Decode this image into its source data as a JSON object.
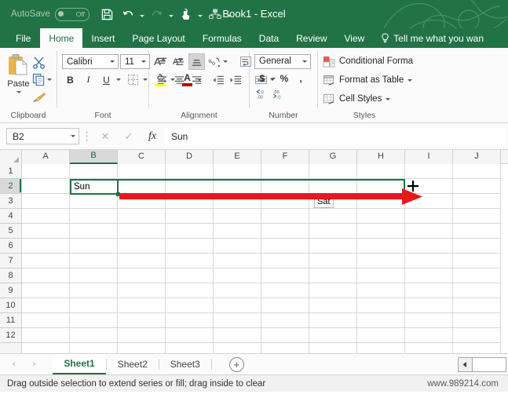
{
  "titlebar": {
    "autosave_label": "AutoSave",
    "autosave_state": "Off",
    "title": "Book1  -  Excel",
    "qat": [
      {
        "name": "save-icon",
        "label": "Save"
      },
      {
        "name": "undo-icon",
        "label": "Undo"
      },
      {
        "name": "redo-icon",
        "label": "Redo"
      },
      {
        "name": "touch-mode-icon",
        "label": "Touch/Mouse Mode"
      },
      {
        "name": "customize-quick-access-icon",
        "label": "Customize Quick Access Toolbar"
      }
    ]
  },
  "tabs": [
    {
      "label": "File",
      "active": false
    },
    {
      "label": "Home",
      "active": true
    },
    {
      "label": "Insert",
      "active": false
    },
    {
      "label": "Page Layout",
      "active": false
    },
    {
      "label": "Formulas",
      "active": false
    },
    {
      "label": "Data",
      "active": false
    },
    {
      "label": "Review",
      "active": false
    },
    {
      "label": "View",
      "active": false
    }
  ],
  "tellme": {
    "label": "Tell me what you wan",
    "icon": "lightbulb-icon"
  },
  "ribbon": {
    "clipboard": {
      "group_label": "Clipboard",
      "paste_label": "Paste",
      "cut_label": "Cut",
      "copy_label": "Copy",
      "format_painter_label": "Format Painter"
    },
    "font": {
      "group_label": "Font",
      "font_name": "Calibri",
      "font_size": "11",
      "bold": "B",
      "italic": "I",
      "underline": "U",
      "increase_size": "A",
      "decrease_size": "A",
      "borders_label": "Borders",
      "fill_color": "#ffff00",
      "font_color": "#c00000",
      "fill_label": "Fill Color",
      "font_color_label": "Font Color",
      "font_color_letter": "A"
    },
    "alignment": {
      "group_label": "Alignment",
      "top_align": "Top Align",
      "middle_align": "Middle Align",
      "bottom_align": "Bottom Align",
      "orientation": "Orientation",
      "wrap_text": "Wrap Text",
      "align_left": "Align Left",
      "align_center": "Center",
      "align_right": "Align Right",
      "decrease_indent": "Decrease Indent",
      "increase_indent": "Increase Indent",
      "merge_center": "Merge & Center"
    },
    "number": {
      "group_label": "Number",
      "format": "General",
      "currency": "$",
      "percent": "%",
      "comma": ",",
      "increase_decimal": "Increase Decimal",
      "decrease_decimal": "Decrease Decimal"
    },
    "styles": {
      "group_label": "Styles",
      "conditional_formatting": "Conditional Forma",
      "format_as_table": "Format as Table",
      "cell_styles": "Cell Styles"
    }
  },
  "formulabar": {
    "namebox": "B2",
    "cancel": "✕",
    "enter": "✓",
    "fx": "fx",
    "content": "Sun"
  },
  "grid": {
    "columns": [
      "A",
      "B",
      "C",
      "D",
      "E",
      "F",
      "G",
      "H",
      "I",
      "J"
    ],
    "selected_column": "B",
    "rows": [
      "1",
      "2",
      "3",
      "4",
      "5",
      "6",
      "7",
      "8",
      "9",
      "10",
      "11",
      "12"
    ],
    "selected_row": "2",
    "active_cell": {
      "ref": "B2",
      "value": "Sun"
    },
    "selection_range": "B2:H2",
    "fill_tooltip": "Sat",
    "cursor": "fill-crosshair"
  },
  "annotation": {
    "arrow_color": "#e8191b",
    "arrow_name": "drag-direction-arrow"
  },
  "sheettabs": {
    "prev_label": "‹",
    "next_label": "›",
    "sheets": [
      {
        "label": "Sheet1",
        "active": true
      },
      {
        "label": "Sheet2",
        "active": false
      },
      {
        "label": "Sheet3",
        "active": false
      }
    ],
    "add_label": "+"
  },
  "statusbar": {
    "message": "Drag outside selection to extend series or fill; drag inside to clear",
    "watermark": "www.989214.com"
  },
  "theme": {
    "excel_green": "#217346",
    "ribbon_bg": "#fbfbfb",
    "grid_line": "#d8d8d8"
  }
}
